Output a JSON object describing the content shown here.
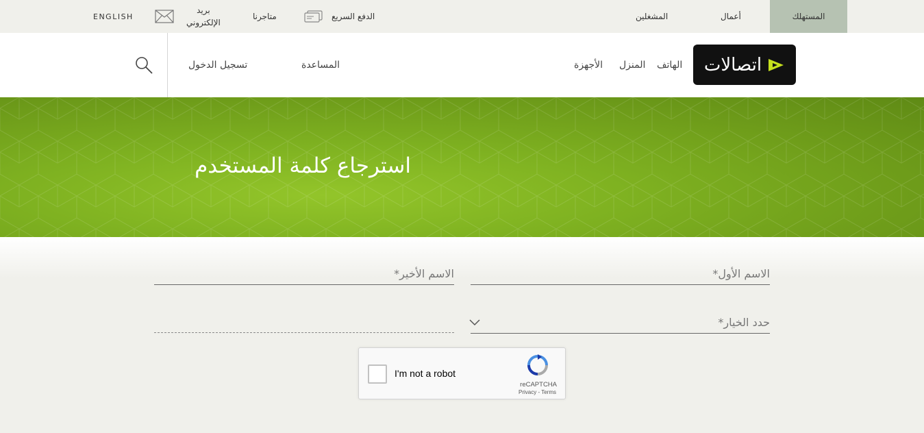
{
  "topbar": {
    "consumer": "المستهلك",
    "business": "أعمال",
    "operators": "المشغلين",
    "quickpay": "الدفع السريع",
    "stores": "متاجرنا",
    "email_line1": "بريد",
    "email_line2": "الإلكتروني",
    "language": "ENGLISH"
  },
  "mainnav": {
    "logo_text": "اتصالات",
    "phone": "الهاتف",
    "home": "المنزل",
    "devices": "الأجهزة",
    "help": "المساعدة",
    "login": "تسجيل الدخول"
  },
  "hero": {
    "title": "استرجاع كلمة المستخدم"
  },
  "form": {
    "first_name_label": "الاسم الأول*",
    "last_name_label": "الاسم الأخير*",
    "select_label": "حدد الخيار*"
  },
  "captcha": {
    "label": "I'm not a robot",
    "brand": "reCAPTCHA",
    "links": "Privacy - Terms"
  },
  "colors": {
    "accent_green": "#7fb221",
    "active_tab": "#b6c2b2",
    "logo_bg": "#111111",
    "logo_mark": "#c6e01e"
  },
  "icons": [
    "quickpay-card-icon",
    "mail-envelope-icon",
    "search-icon",
    "chevron-down-icon",
    "recaptcha-logo-icon",
    "etisalat-logo-mark-icon"
  ]
}
